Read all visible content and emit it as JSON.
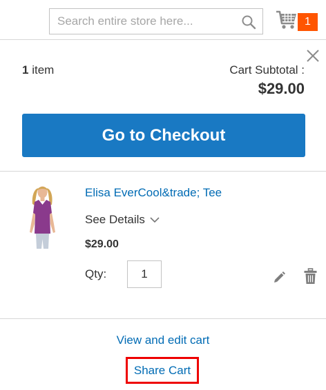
{
  "header": {
    "search": {
      "placeholder": "Search entire store here...",
      "value": ""
    },
    "cart": {
      "count": "1"
    }
  },
  "minicart": {
    "items_count": "1",
    "items_label": "item",
    "subtotal_label": "Cart Subtotal :",
    "subtotal_price": "$29.00",
    "checkout_label": "Go to Checkout",
    "items": [
      {
        "name": "Elisa EverCool&trade; Tee",
        "details_label": "See Details",
        "price": "$29.00",
        "qty_label": "Qty:",
        "qty": "1"
      }
    ],
    "view_edit_label": "View and edit cart",
    "share_label": "Share Cart"
  },
  "colors": {
    "primary": "#1979c3",
    "link": "#006bb4",
    "counter": "#ff5501",
    "highlight": "#ee0000"
  },
  "icons": [
    "search-icon",
    "cart-icon",
    "close-icon",
    "chevron-down-icon",
    "pencil-icon",
    "trash-icon"
  ]
}
